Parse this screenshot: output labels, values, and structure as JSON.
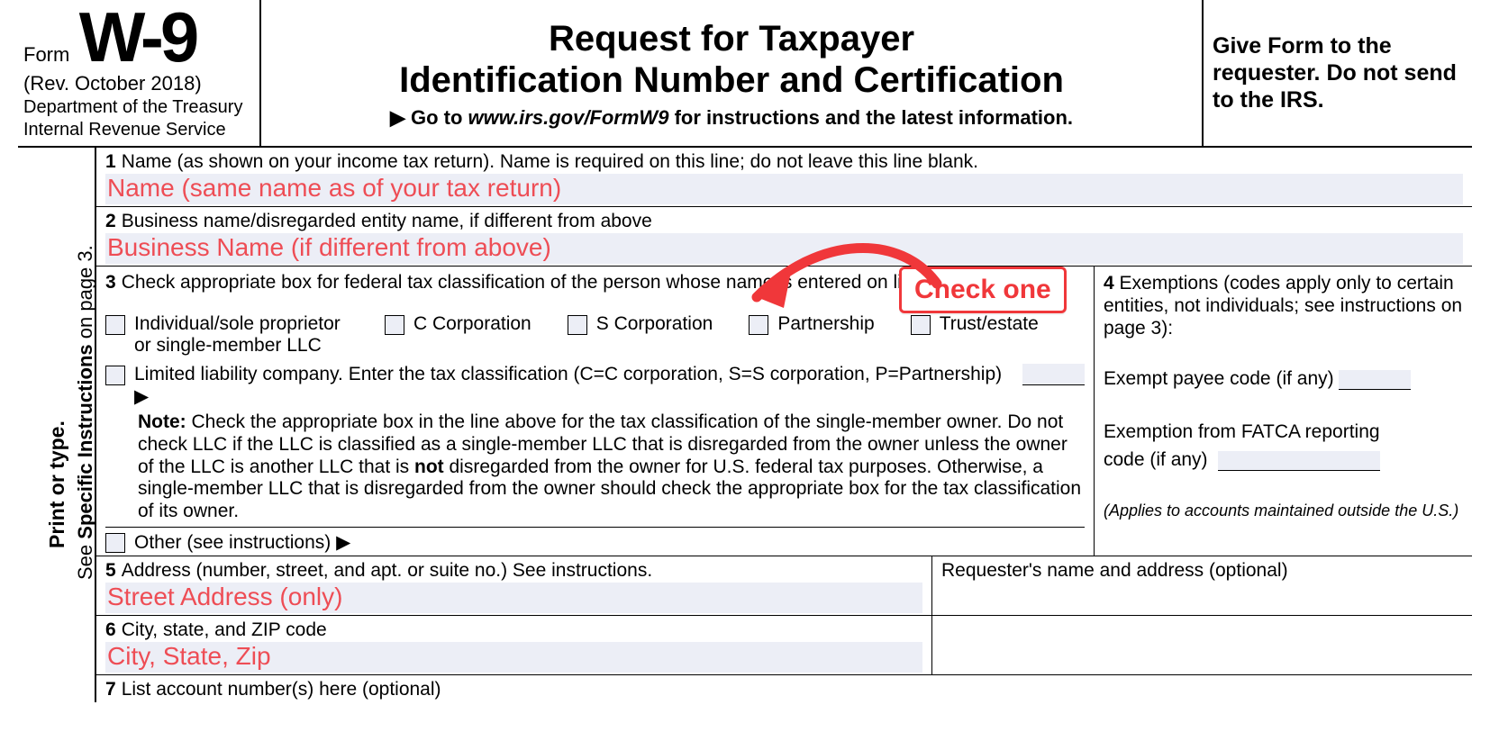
{
  "header": {
    "form_word": "Form",
    "form_number": "W-9",
    "revision": "(Rev. October 2018)",
    "dept1": "Department of the Treasury",
    "dept2": "Internal Revenue Service",
    "title_line1": "Request for Taxpayer",
    "title_line2": "Identification Number and Certification",
    "goto_prefix": "▶ Go to",
    "goto_url": "www.irs.gov/FormW9",
    "goto_suffix": "for instructions and the latest information.",
    "give_form": "Give Form to the requester. Do not send to the IRS."
  },
  "side": {
    "outer": "Print or type.",
    "inner_prefix": "See ",
    "inner_bold": "Specific Instructions",
    "inner_suffix": " on page 3."
  },
  "lines": {
    "l1_num": "1",
    "l1_text": "Name (as shown on your income tax return). Name is required on this line; do not leave this line blank.",
    "l1_fill": "Name (same name as of your tax return)",
    "l2_num": "2",
    "l2_text": "Business name/disregarded entity name, if different from above",
    "l2_fill": "Business Name (if different from above)",
    "l3_num": "3",
    "l3_text": "Check appropriate box for federal tax classification of the person whose name is entered on line 1.",
    "l4_num": "4",
    "l4_text": "Exemptions (codes apply only to certain entities, not individuals; see instructions on page 3):",
    "l5_num": "5",
    "l5_text": "Address (number, street, and apt. or suite no.) See instructions.",
    "l5_fill": "Street Address (only)",
    "l6_num": "6",
    "l6_text": "City, state, and ZIP code",
    "l6_fill": "City, State, Zip",
    "l7_num": "7",
    "l7_text": "List account number(s) here (optional)",
    "requester": "Requester's name and address (optional)"
  },
  "checkboxes": {
    "individual": "Individual/sole proprietor or single-member LLC",
    "ccorp": "C Corporation",
    "scorp": "S Corporation",
    "partnership": "Partnership",
    "trust": "Trust/estate",
    "llc": "Limited liability company. Enter the tax classification (C=C corporation, S=S corporation, P=Partnership) ▶",
    "other": "Other (see instructions) ▶"
  },
  "note": {
    "label": "Note:",
    "text": " Check the appropriate box in the line above for the tax classification of the single-member owner.  Do not check LLC if the LLC is classified as a single-member LLC that is disregarded from the owner unless the owner of the LLC is another LLC that is ",
    "bold2": "not",
    "text2": " disregarded from the owner for U.S. federal tax purposes. Otherwise, a single-member LLC that is disregarded from the owner should check the appropriate box for the tax classification of its owner."
  },
  "exempt": {
    "payee": "Exempt payee code (if any)",
    "fatca1": "Exemption from FATCA reporting",
    "fatca2": "code (if any)",
    "applies": "(Applies to accounts maintained outside the U.S.)"
  },
  "callout": {
    "text": "Check one"
  }
}
